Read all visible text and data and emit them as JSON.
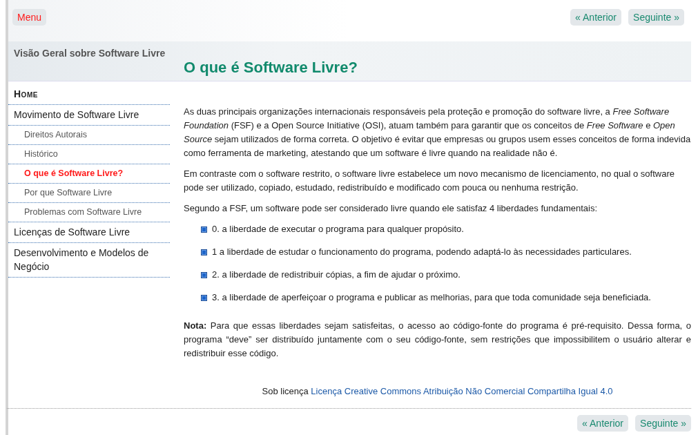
{
  "header": {
    "menu_button": "Menu",
    "nav": [
      "« Anterior",
      "Seguinte »"
    ]
  },
  "banner": {
    "section_title": "Visão Geral sobre Software Livre",
    "page_title": "O que é Software Livre?"
  },
  "sidebar": {
    "items": [
      {
        "label": "Home",
        "kind": "home",
        "selected": false
      },
      {
        "label": "Movimento de Software Livre",
        "kind": "top",
        "selected": false
      },
      {
        "label": "Direitos Autorais",
        "kind": "sub",
        "selected": false
      },
      {
        "label": "Histórico",
        "kind": "sub",
        "selected": false
      },
      {
        "label": "O que é Software Livre?",
        "kind": "sub",
        "selected": true
      },
      {
        "label": "Por que Software Livre",
        "kind": "sub",
        "selected": false
      },
      {
        "label": "Problemas com Software Livre",
        "kind": "sub",
        "selected": false
      },
      {
        "label": "Licenças de Software Livre",
        "kind": "top",
        "selected": false
      },
      {
        "label": "Desenvolvimento e Modelos de Negócio",
        "kind": "top",
        "selected": false
      }
    ]
  },
  "content": {
    "paragraphs": [
      "As duas principais organizações internacionais responsáveis pela proteção e promoção do software livre, a *Free Software Foundation* (FSF) e a Open Source Initiative (OSI), atuam também para garantir que os conceitos de *Free Software* e *Open Source*  sejam utilizados de forma correta. O objetivo é evitar que empresas ou grupos usem esses conceitos de forma indevida como ferramenta de marketing, atestando que um software é livre quando na realidade não é.",
      "Em contraste com o software restrito, o software livre estabelece um novo mecanismo de licenciamento, no qual o software pode ser utilizado, copiado, estudado, redistribuído e modificado com pouca ou nenhuma restrição.",
      "Segundo a FSF, um software pode ser considerado livre quando ele satisfaz 4 liberdades fundamentais:"
    ],
    "freedoms": [
      "0. a liberdade de executar o programa para qualquer propósito.",
      "1 a liberdade de estudar o funcionamento do programa, podendo adaptá-lo às necessidades particulares.",
      "2. a liberdade de redistribuir cópias, a fim de ajudar o próximo.",
      "3. a liberdade de aperfeiçoar o programa e publicar as melhorias, para que toda comunidade seja beneficiada."
    ],
    "note": "**Nota:** Para que essas liberdades sejam satisfeitas, o acesso ao código-fonte do programa é pré-requisito. Dessa forma, o programa “deve” ser distribuído juntamente com o seu código-fonte, sem restrições que impossibilitem o usuário alterar e redistribuir esse código."
  },
  "footer": {
    "license_prefix": "Sob licença",
    "license_link": "Licença Creative Commons Atribuição Não Comercial Compartilha Igual 4.0",
    "nav": [
      "« Anterior",
      "Seguinte »"
    ]
  }
}
